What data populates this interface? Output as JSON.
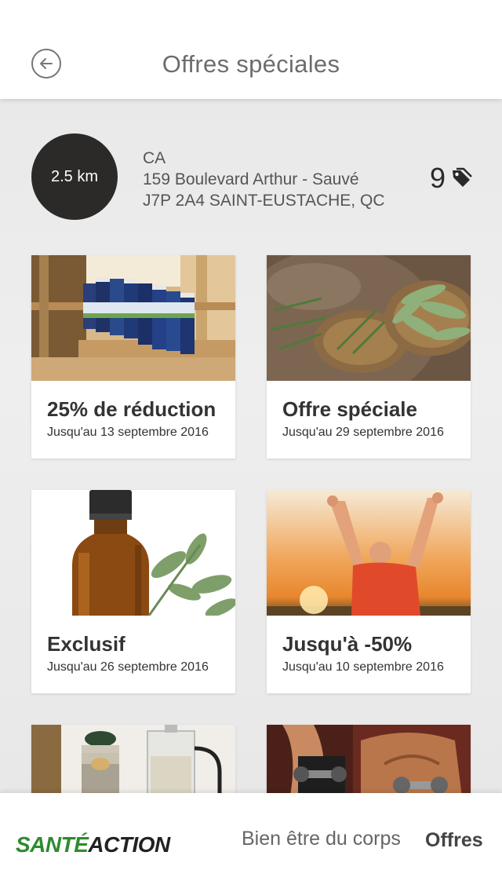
{
  "header": {
    "title": "Offres spéciales",
    "back_icon": "arrow-left-circle-icon"
  },
  "store": {
    "distance": "2.5 km",
    "address_line1": "CA",
    "address_line2": "159 Boulevard Arthur - Sauvé",
    "address_line3": "J7P 2A4 SAINT-EUSTACHE, QC",
    "offer_count": "9",
    "offer_icon": "price-tag-icon"
  },
  "offers": [
    {
      "title": "25% de réduction",
      "date": "Jusqu'au 13 septembre 2016",
      "image": "supplement-jars-on-shelf"
    },
    {
      "title": "Offre spéciale",
      "date": "Jusqu'au 29 septembre  2016",
      "image": "herbs-in-wooden-bowls"
    },
    {
      "title": "Exclusif",
      "date": "Jusqu'au 26 septembre 2016",
      "image": "essential-oil-bottle-with-leaves"
    },
    {
      "title": "Jusqu'à -50%",
      "date": "Jusqu'au 10 septembre 2016",
      "image": "man-raising-arms-at-sunset"
    },
    {
      "title": "",
      "date": "",
      "image": "succulent-jar-and-teapot"
    },
    {
      "title": "",
      "date": "",
      "image": "people-lifting-dumbbells"
    }
  ],
  "bottom_nav": {
    "logo_part1": "SANTÉ",
    "logo_part2": "ACTION",
    "link_body": "Bien être du corps",
    "link_offers": "Offres"
  },
  "colors": {
    "logo_green": "#2e8b2e",
    "dark_badge": "#2b2a29",
    "text_gray": "#555555"
  }
}
